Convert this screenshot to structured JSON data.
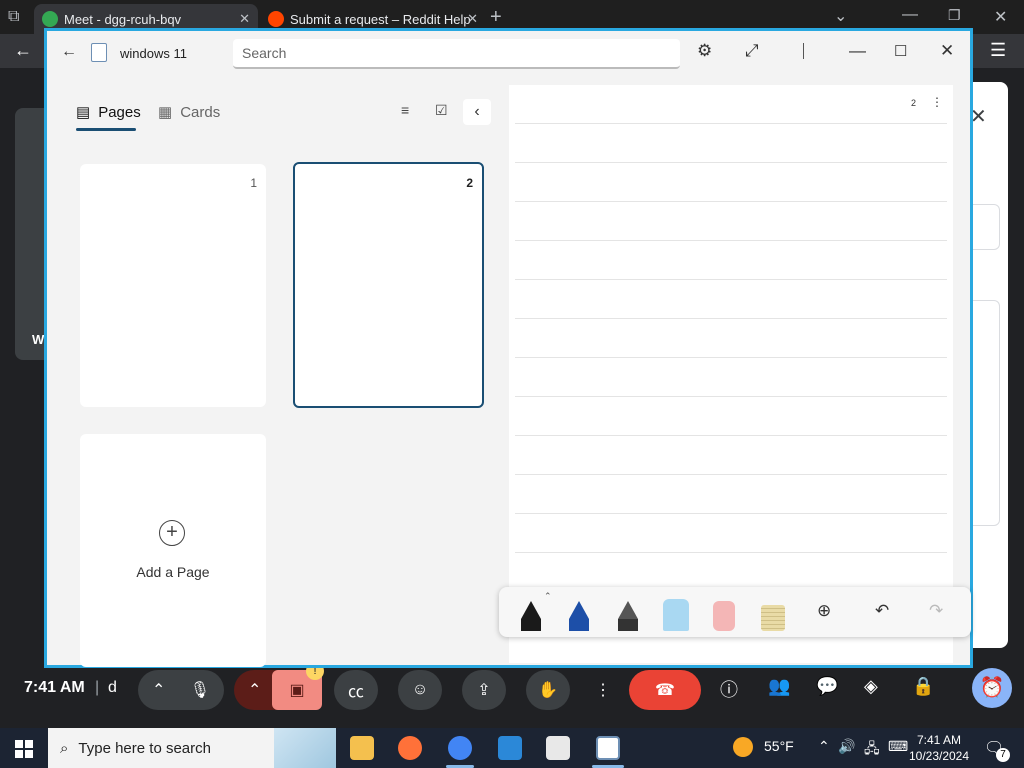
{
  "browser": {
    "tabs": [
      {
        "title": "Meet - dgg-rcuh-bqv",
        "active": true
      },
      {
        "title": "Submit a request – Reddit Help",
        "active": false
      }
    ]
  },
  "meet": {
    "side_letter": "W",
    "time": "7:41 AM",
    "separator": "|",
    "meeting_code_fragment": "d",
    "reaction_badge": "!"
  },
  "whiteboard": {
    "title": "windows 11",
    "search_placeholder": "Search",
    "tabs": [
      {
        "label": "Pages",
        "icon": "pages-icon",
        "selected": true
      },
      {
        "label": "Cards",
        "icon": "cards-icon",
        "selected": false
      }
    ],
    "pages": [
      {
        "number": "1",
        "selected": false
      },
      {
        "number": "2",
        "selected": true
      }
    ],
    "add_page_label": "Add a Page",
    "canvas_page_number": "2",
    "tools": [
      {
        "name": "black-pen",
        "color": "#1a1a1a"
      },
      {
        "name": "blue-pen",
        "color": "#1d4fa8"
      },
      {
        "name": "pencil",
        "color": "#333333"
      },
      {
        "name": "highlighter",
        "color": "#a9d8f2"
      },
      {
        "name": "eraser",
        "color": "#f4b6b6"
      },
      {
        "name": "ruler",
        "color": "#e9dba6"
      }
    ],
    "accent_color": "#1a4e73",
    "window_border_color": "#29a8e0"
  },
  "taskbar": {
    "search_placeholder": "Type here to search",
    "weather": "55°F",
    "time": "7:41 AM",
    "date": "10/23/2024",
    "notification_count": "7"
  }
}
